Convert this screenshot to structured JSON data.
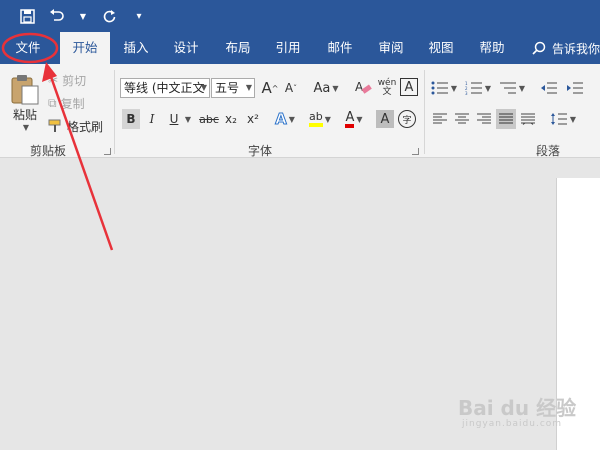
{
  "qat": {
    "save_icon": "save-icon",
    "undo_icon": "undo-icon",
    "redo_icon": "redo-icon",
    "customize_icon": "customize-icon"
  },
  "tabs": [
    {
      "label": "文件"
    },
    {
      "label": "开始"
    },
    {
      "label": "插入"
    },
    {
      "label": "设计"
    },
    {
      "label": "布局"
    },
    {
      "label": "引用"
    },
    {
      "label": "邮件"
    },
    {
      "label": "审阅"
    },
    {
      "label": "视图"
    },
    {
      "label": "帮助"
    }
  ],
  "tellme": "告诉我你",
  "clipboard": {
    "paste": "粘贴",
    "cut": "剪切",
    "copy": "复制",
    "format_painter": "格式刷",
    "label": "剪贴板"
  },
  "font": {
    "name": "等线 (中文正文",
    "size": "五号",
    "pinyin": "wén",
    "label": "字体",
    "bold": "B",
    "italic": "I",
    "underline": "U",
    "strike": "abc",
    "subscript": "x₂",
    "superscript": "x²",
    "aa": "Aa"
  },
  "paragraph": {
    "label": "段落"
  },
  "watermark": {
    "main": "Bai du 经验",
    "sub": "jingyan.baidu.com"
  },
  "colors": {
    "accent": "#2b579a",
    "annotation": "#e8323a",
    "highlight": "#ffff00",
    "font_color": "#e00000"
  }
}
